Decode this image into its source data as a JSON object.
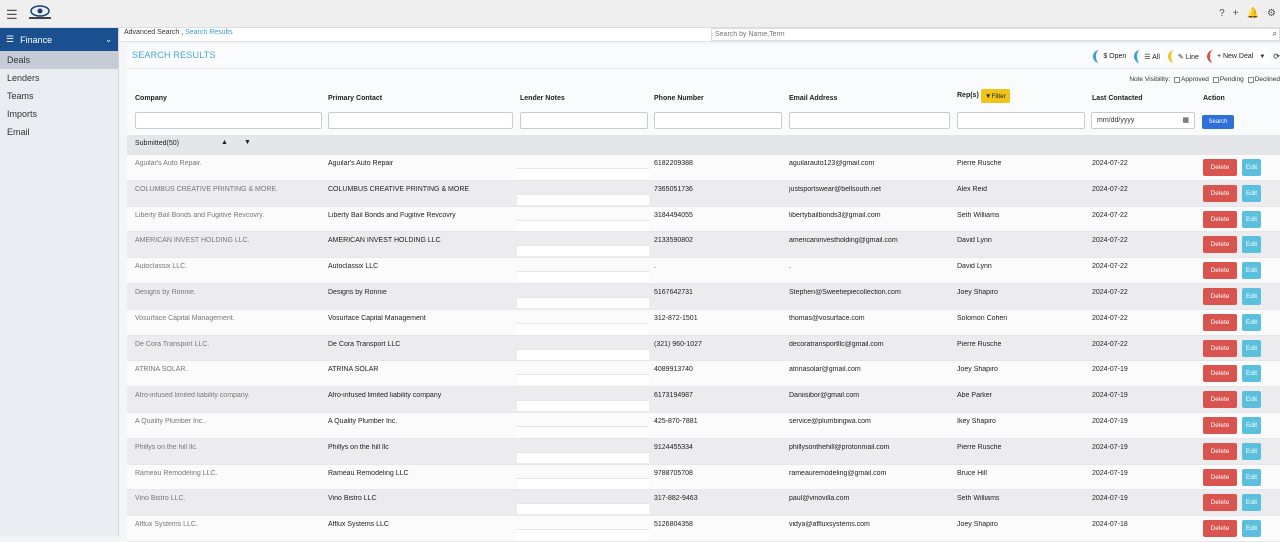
{
  "topbar": {
    "menu_icon": "☰",
    "help_icon": "?",
    "plus_icon": "+",
    "bell_icon": "🔔",
    "settings_icon": "⚙"
  },
  "sidebar": {
    "module": "Finance",
    "items": [
      {
        "label": "Deals",
        "active": true
      },
      {
        "label": "Lenders",
        "active": false
      },
      {
        "label": "Teams",
        "active": false
      },
      {
        "label": "Imports",
        "active": false
      },
      {
        "label": "Email",
        "active": false
      }
    ]
  },
  "breadcrumb": {
    "parent": "Advanced Search ,",
    "current": "Search Results"
  },
  "global_search": {
    "placeholder": "Search by Name,Term"
  },
  "title": "SEARCH RESULTS",
  "toolbar": {
    "open": "$ Open",
    "all": "☰ All",
    "line": "✎ Line",
    "new_deal": "+ New Deal"
  },
  "note_visibility": {
    "label": "Note Visibility:",
    "approved": "Approved",
    "pending": "Pending",
    "declined": "Declined"
  },
  "columns": {
    "company": "Company",
    "contact": "Primary Contact",
    "notes": "Lender Notes",
    "phone": "Phone Number",
    "email": "Email Address",
    "rep": "Rep(s)",
    "filter": "Filter",
    "last": "Last Contacted",
    "action": "Action"
  },
  "date_placeholder": "mm/dd/yyyy",
  "search_button": "Search",
  "group": {
    "label": "Submitted(50)",
    "up": "▲",
    "down": "▼"
  },
  "row_actions": {
    "delete": "Delete",
    "edit": "Edit"
  },
  "rows": [
    {
      "company": "Aguilar's Auto Repair.",
      "contact": "Aguilar's Auto Repair",
      "phone": "6182209388",
      "email": "aguilarauto123@gmail.com",
      "rep": "Pierre Rusche",
      "date": "2024-07-22"
    },
    {
      "company": "COLUMBUS CREATIVE PRINTING & MORE.",
      "contact": "COLUMBUS CREATIVE PRINTING & MORE",
      "phone": "7365051736",
      "email": "justsportswear@bellsouth.net",
      "rep": "Alex Reid",
      "date": "2024-07-22"
    },
    {
      "company": "Liberty Bail Bonds and Fugitive Revcovry.",
      "contact": "Liberty Bail Bonds and Fugitive Revcovry",
      "phone": "3184494055",
      "email": "libertybailbonds3@gmail.com",
      "rep": "Seth Williams",
      "date": "2024-07-22"
    },
    {
      "company": "AMERICAN INVEST HOLDING LLC.",
      "contact": "AMERICAN INVEST HOLDING LLC",
      "phone": "2133590802",
      "email": "americaninvestholding@gmail.com",
      "rep": "David Lynn",
      "date": "2024-07-22"
    },
    {
      "company": "Autoclassix LLC.",
      "contact": "Autoclassix LLC",
      "phone": ".",
      "email": ".",
      "rep": "David Lynn",
      "date": "2024-07-22"
    },
    {
      "company": "Designs by Ronnie.",
      "contact": "Designs by Ronnie",
      "phone": "5167642731",
      "email": "Stephen@Sweetiepiecollection.com",
      "rep": "Joey Shapiro",
      "date": "2024-07-22"
    },
    {
      "company": "Vosurface Capital Management.",
      "contact": "Vosurface Capital Management",
      "phone": "312-872-1501",
      "email": "thomas@vosurface.com",
      "rep": "Solomon Cohen",
      "date": "2024-07-22"
    },
    {
      "company": "De Cora Transport LLC.",
      "contact": "De Cora Transport LLC",
      "phone": "(321) 960-1027",
      "email": "decoratransportllc@gmail.com",
      "rep": "Pierre Rusche",
      "date": "2024-07-22"
    },
    {
      "company": "ATRINA SOLAR.",
      "contact": "ATRINA SOLAR",
      "phone": "4089913740",
      "email": "atrinasolar@gmail.com",
      "rep": "Joey Shapiro",
      "date": "2024-07-19"
    },
    {
      "company": "Afro-infused limited liability company.",
      "contact": "Afro-infused limited liability company",
      "phone": "6173194987",
      "email": "Daniisibor@gmail.com",
      "rep": "Abe Parker",
      "date": "2024-07-19"
    },
    {
      "company": "A Quality Plumber Inc..",
      "contact": "A Quality Plumber Inc.",
      "phone": "425-870-7881",
      "email": "service@plumbingwa.com",
      "rep": "Ikey Shapiro",
      "date": "2024-07-19"
    },
    {
      "company": "Phillys on the hill llc.",
      "contact": "Phillys on the hill llc",
      "phone": "9124455334",
      "email": "phillysonthehill@protonmail.com",
      "rep": "Pierre Rusche",
      "date": "2024-07-19"
    },
    {
      "company": "Rameau Remodeling LLC.",
      "contact": "Rameau Remodeling LLC",
      "phone": "9788705708",
      "email": "rameauremodeling@gmail.com",
      "rep": "Bruce Hill",
      "date": "2024-07-19"
    },
    {
      "company": "Vino Bistro LLC.",
      "contact": "Vino Bistro LLC",
      "phone": "317-882-9463",
      "email": "paul@vinovilla.com",
      "rep": "Seth Williams",
      "date": "2024-07-19"
    },
    {
      "company": "Afflux Systems LLC.",
      "contact": "Afflux Systems LLC",
      "phone": "5126804358",
      "email": "vidya@affluxsystems.com",
      "rep": "Joey Shapiro",
      "date": "2024-07-18"
    }
  ]
}
